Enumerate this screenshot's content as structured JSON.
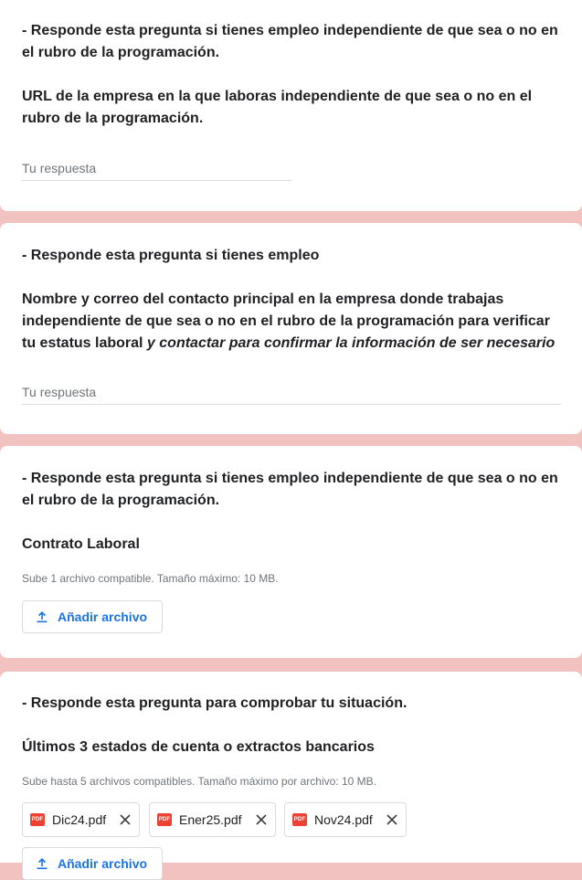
{
  "card1": {
    "intro": "- Responde esta pregunta si tienes empleo  independiente de que sea o no en el rubro de la programación.",
    "question": "URL de la empresa en la que laboras  independiente de que sea o no en el rubro de la programación.",
    "placeholder": "Tu respuesta"
  },
  "card2": {
    "intro": "- Responde esta pregunta si tienes empleo",
    "question_plain": "Nombre y correo del contacto principal en la empresa donde trabajas independiente de que sea o no en el rubro de la programación  para verificar tu estatus laboral ",
    "question_italic": "y contactar para confirmar la información de ser necesario",
    "placeholder": "Tu respuesta"
  },
  "card3": {
    "intro": "- Responde esta pregunta si tienes empleo  independiente de que sea o no en el rubro de la programación.",
    "question": "Contrato Laboral",
    "hint": "Sube 1 archivo compatible. Tamaño máximo: 10 MB.",
    "upload_label": "Añadir archivo"
  },
  "card4": {
    "intro": "- Responde esta pregunta para comprobar tu situación.",
    "question": "Últimos 3 estados de cuenta o extractos bancarios",
    "hint": "Sube hasta 5 archivos compatibles. Tamaño máximo por archivo: 10 MB.",
    "files": [
      {
        "name": "Dic24.pdf",
        "icon": "pdf-file-icon"
      },
      {
        "name": "Ener25.pdf",
        "icon": "pdf-file-icon"
      },
      {
        "name": "Nov24.pdf",
        "icon": "pdf-file-icon"
      }
    ],
    "pdf_badge": "PDF",
    "upload_label": "Añadir archivo"
  },
  "colors": {
    "background": "#f2c2c0",
    "accent": "#1a73e8",
    "pdf": "#ea4335"
  }
}
